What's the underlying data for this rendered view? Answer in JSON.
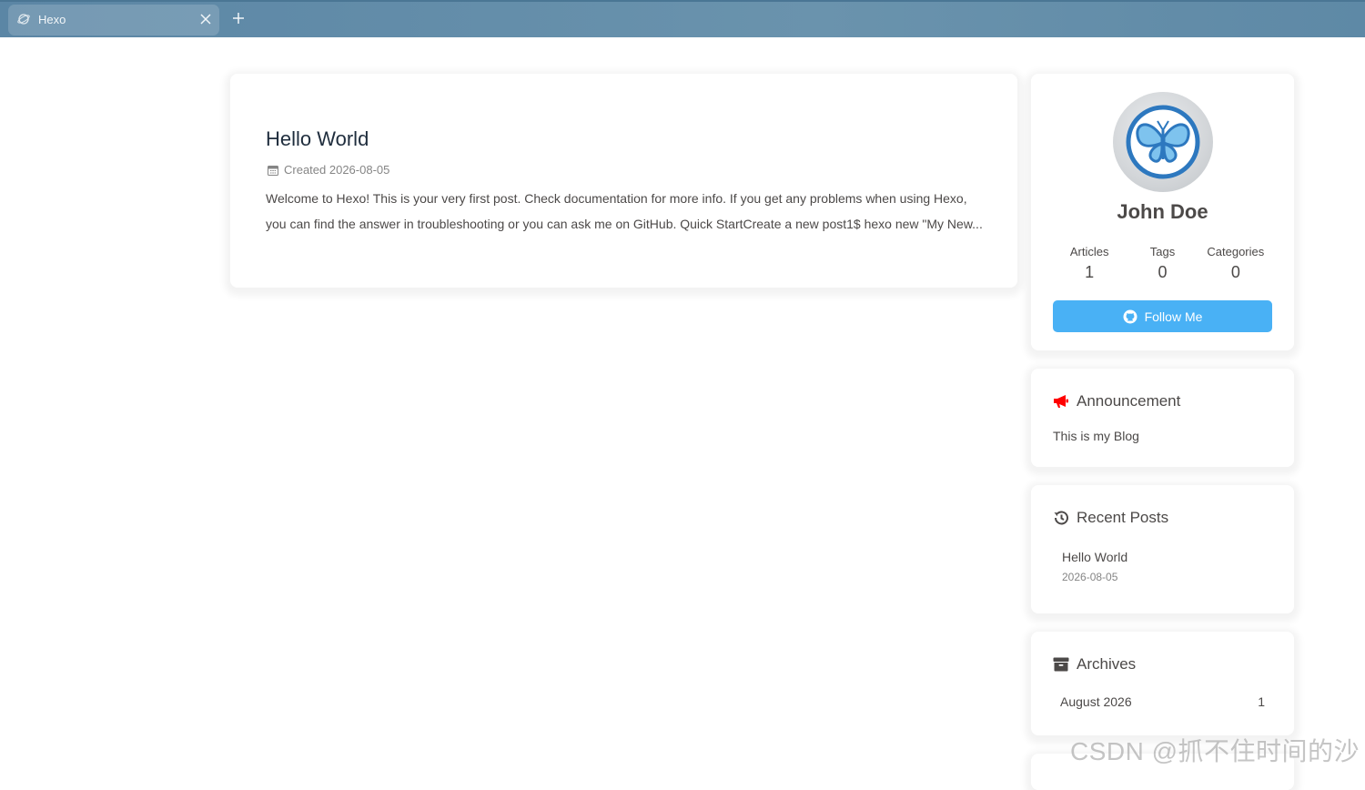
{
  "browser": {
    "tab_title": "Hexo",
    "tab_icon": "planet-icon",
    "close_icon": "close-icon",
    "new_tab_icon": "plus-icon"
  },
  "post": {
    "title": "Hello World",
    "meta_icon": "calendar-icon",
    "meta": "Created 2026-08-05",
    "excerpt": "Welcome to Hexo! This is your very first post. Check documentation for more info. If you get any problems when using Hexo, you can find the answer in troubleshooting or you can ask me on GitHub. Quick StartCreate a new post1$ hexo new \"My New..."
  },
  "author": {
    "name": "John Doe",
    "avatar_icon": "butterfly-icon",
    "stats": [
      {
        "label": "Articles",
        "value": "1"
      },
      {
        "label": "Tags",
        "value": "0"
      },
      {
        "label": "Categories",
        "value": "0"
      }
    ],
    "follow_label": "Follow Me",
    "follow_icon": "github-icon",
    "follow_color": "#49b1f5"
  },
  "announcement": {
    "title": "Announcement",
    "icon": "bullhorn-icon",
    "icon_color": "#ff0000",
    "text": "This is my Blog"
  },
  "recent_posts": {
    "title": "Recent Posts",
    "icon": "history-icon",
    "items": [
      {
        "title": "Hello World",
        "date": "2026-08-05"
      }
    ]
  },
  "archives": {
    "title": "Archives",
    "icon": "archive-icon",
    "items": [
      {
        "label": "August 2026",
        "count": "1"
      }
    ]
  },
  "watermark": "CSDN @抓不住时间的沙"
}
